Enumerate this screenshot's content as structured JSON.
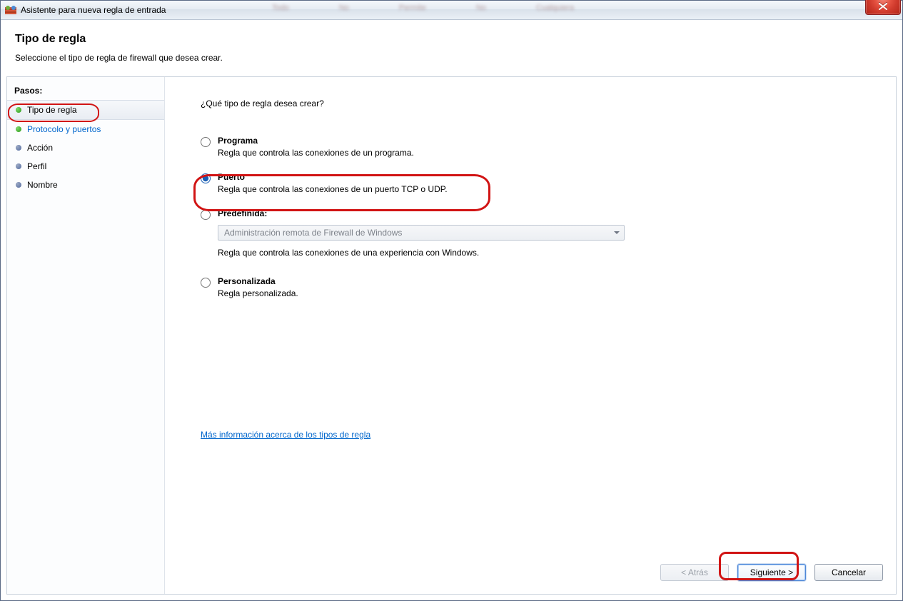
{
  "window": {
    "title": "Asistente para nueva regla de entrada"
  },
  "header": {
    "heading": "Tipo de regla",
    "subtitle": "Seleccione el tipo de regla de firewall que desea crear."
  },
  "sidebar": {
    "title": "Pasos:",
    "steps": [
      {
        "label": "Tipo de regla",
        "state": "current"
      },
      {
        "label": "Protocolo y puertos",
        "state": "pending"
      },
      {
        "label": "Acción",
        "state": "future"
      },
      {
        "label": "Perfil",
        "state": "future"
      },
      {
        "label": "Nombre",
        "state": "future"
      }
    ]
  },
  "main": {
    "question": "¿Qué tipo de regla desea crear?",
    "options": {
      "program": {
        "title": "Programa",
        "desc": "Regla que controla las conexiones de un programa.",
        "checked": false
      },
      "port": {
        "title": "Puerto",
        "desc": "Regla que controla las conexiones de un puerto TCP o UDP.",
        "checked": true
      },
      "predefined": {
        "title": "Predefinida:",
        "desc": "Regla que controla las conexiones de una experiencia con Windows.",
        "checked": false,
        "dropdown_value": "Administración remota de Firewall de Windows"
      },
      "custom": {
        "title": "Personalizada",
        "desc": "Regla personalizada.",
        "checked": false
      }
    },
    "more_info": "Más información acerca de los tipos de regla"
  },
  "footer": {
    "back": "< Atrás",
    "next": "Siguiente >",
    "cancel": "Cancelar"
  }
}
